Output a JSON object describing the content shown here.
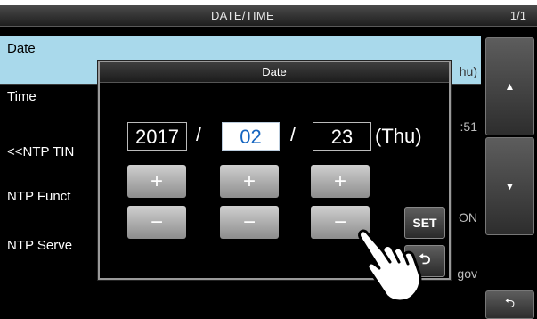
{
  "title_bar": {
    "title": "DATE/TIME",
    "page": "1/1"
  },
  "list": {
    "date": {
      "label": "Date",
      "value": "hu)"
    },
    "time": {
      "label": "Time",
      "value": ":51"
    },
    "ntp_time": {
      "label": "<<NTP TIN"
    },
    "ntp_function": {
      "label": "NTP Funct",
      "value": "ON"
    },
    "ntp_server": {
      "label": "NTP Serve",
      "value": "gov"
    }
  },
  "side_buttons": {
    "up": "▲",
    "down": "▼",
    "back": "⮌"
  },
  "dialog": {
    "title": "Date",
    "year": "2017",
    "month": "02",
    "day": "23",
    "separator": "/",
    "weekday": "(Thu)",
    "plus": "+",
    "minus": "−",
    "set_label": "SET",
    "back_label": "⮌"
  },
  "colors": {
    "selected_row": "#a9d9eb",
    "month_text": "#1565c0"
  }
}
